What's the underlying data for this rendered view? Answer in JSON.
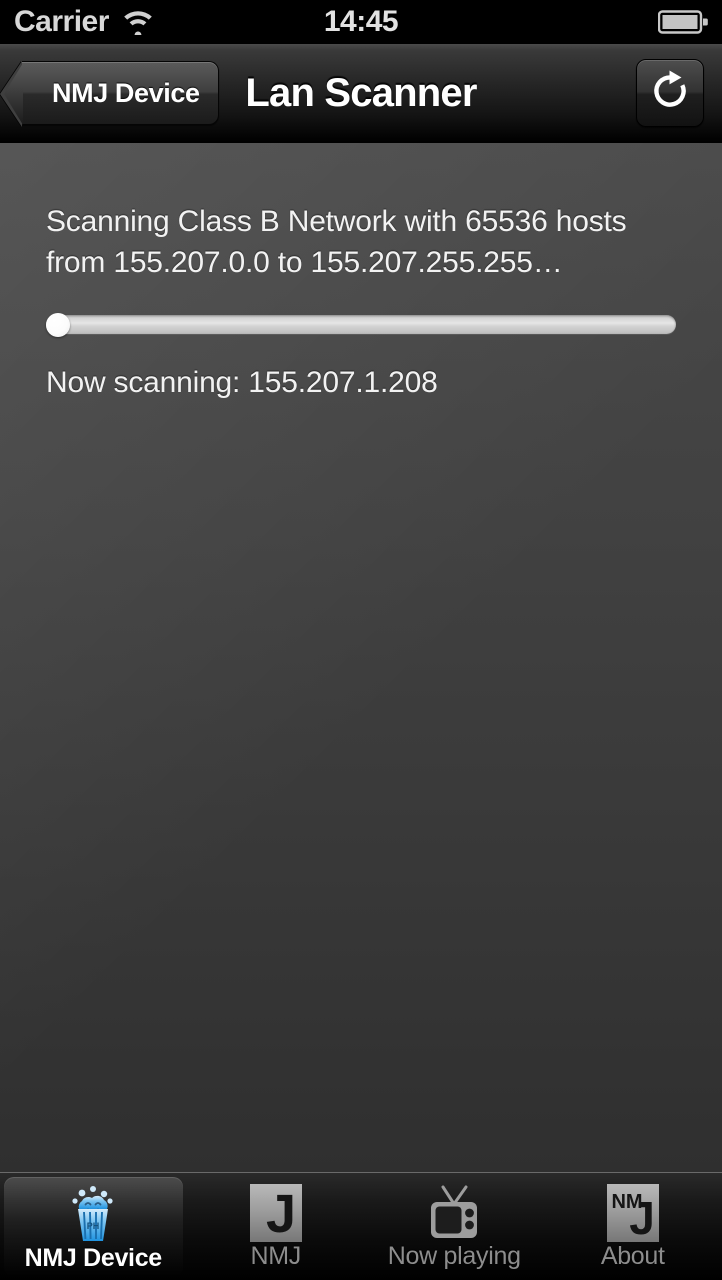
{
  "status_bar": {
    "carrier": "Carrier",
    "time": "14:45",
    "wifi_icon": "wifi-icon",
    "battery_icon": "battery-icon"
  },
  "nav_bar": {
    "back_label": "NMJ Device",
    "title": "Lan Scanner",
    "refresh_icon": "refresh-icon"
  },
  "main": {
    "scan_description": "Scanning Class B Network with 65536 hosts from 155.207.0.0 to 155.207.255.255…",
    "now_scanning_label": "Now scanning: 155.207.1.208",
    "progress_percent": 0
  },
  "tab_bar": {
    "tabs": [
      {
        "label": "NMJ Device",
        "icon": "popcorn-icon",
        "selected": true
      },
      {
        "label": "NMJ",
        "icon": "nmj-j-logo-icon",
        "selected": false
      },
      {
        "label": "Now playing",
        "icon": "television-icon",
        "selected": false
      },
      {
        "label": "About",
        "icon": "nmj-logo-icon",
        "selected": false
      }
    ]
  },
  "colors": {
    "accent": "#4aa8e8",
    "content_bg_top": "#494949",
    "content_bg_bottom": "#2f2f2f",
    "nav_bg": "#1b1b1b",
    "text": "#f2f2f2",
    "tab_label_inactive": "#8d8d8d"
  }
}
